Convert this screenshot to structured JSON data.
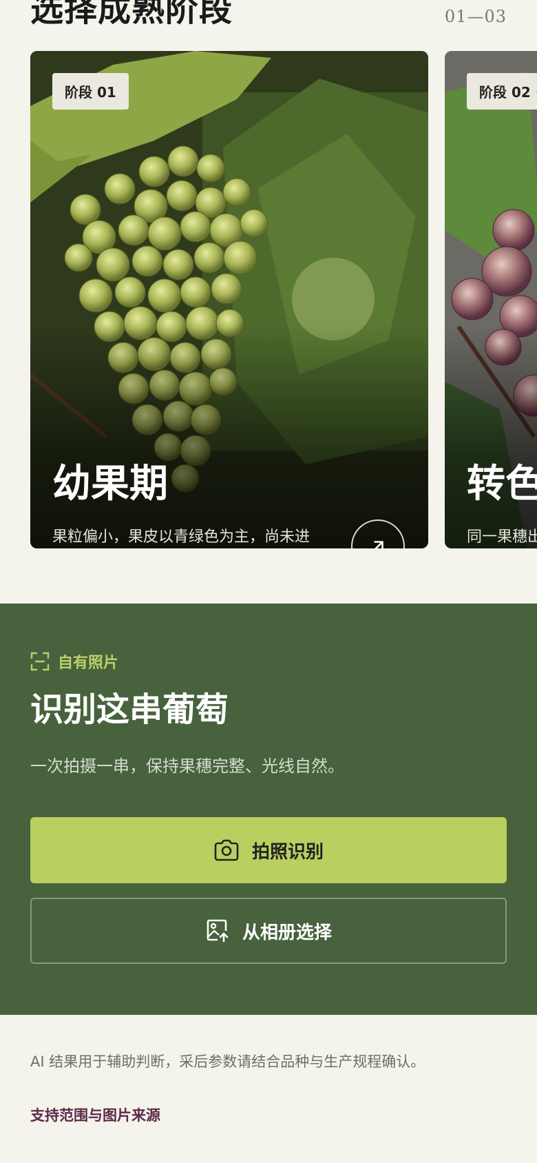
{
  "section": {
    "title": "选择成熟阶段",
    "counter": "01—03"
  },
  "cards": [
    {
      "stage": "阶段 01",
      "title": "幼果期",
      "description": "果粒偏小，果皮以青绿色为主，尚未进入集中转色。"
    },
    {
      "stage": "阶段 02 ·",
      "title": "转色",
      "description": "同一果穗出现颜色变化，糖分逐渐积累，成熟进"
    }
  ],
  "identify": {
    "tag": "自有照片",
    "title": "识别这串葡萄",
    "subtitle": "一次拍摄一串，保持果穗完整、光线自然。",
    "camera_button": "拍照识别",
    "album_button": "从相册选择"
  },
  "footer": {
    "disclaimer": "AI 结果用于辅助判断，采后参数请结合品种与生产规程确认。",
    "support_link": "支持范围与图片来源"
  },
  "colors": {
    "accent_green": "#47623d",
    "lime": "#b9cf5f",
    "plum": "#5a2a47",
    "background": "#f4f3ec"
  }
}
